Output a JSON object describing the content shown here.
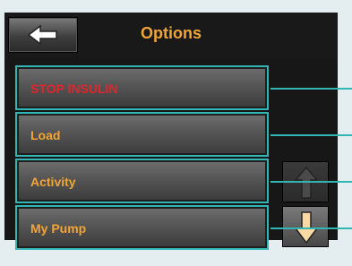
{
  "header": {
    "title": "Options",
    "back_icon": "arrow-left-icon"
  },
  "menu": {
    "items": [
      {
        "label": "STOP INSULIN",
        "color": "#e0262b"
      },
      {
        "label": "Load",
        "color": "#f1a537"
      },
      {
        "label": "Activity",
        "color": "#f1a537"
      },
      {
        "label": "My Pump",
        "color": "#f1a537"
      }
    ]
  },
  "scroll": {
    "up_icon": "arrow-up-icon",
    "down_icon": "arrow-down-icon",
    "up_enabled": false,
    "down_enabled": true
  },
  "colors": {
    "accent": "#f1a537",
    "highlight": "#32b6b4",
    "danger": "#e0262b",
    "background": "#171717"
  }
}
